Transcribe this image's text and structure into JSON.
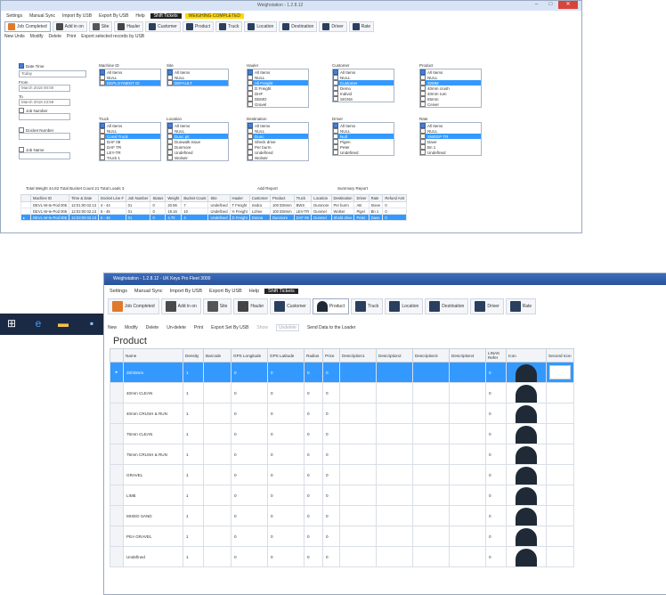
{
  "back_window": {
    "title": "Weighstation - 1.2.8.12",
    "menu": [
      "Settings",
      "Manual Sync",
      "Import By USB",
      "Export By USB",
      "Help"
    ],
    "menu_dark": "Shift Tickets",
    "menu_yellow": "WEIGHING COMPLETED",
    "tabs": [
      "Job Completed",
      "Add in on",
      "Site",
      "Hauler",
      "Customer",
      "Product",
      "Truck",
      "Location",
      "Destination",
      "Driver",
      "Rate"
    ],
    "toolbar": [
      "New Units",
      "Modify",
      "Delete",
      "Print",
      "Export selected records by USB"
    ],
    "filters": {
      "date_time": "Date Time",
      "today": "Today",
      "from": "From",
      "to": "To",
      "from_value": "March 2018 00:00",
      "to_value": "March 2018 23:59",
      "job_number": "Job Number",
      "docket_number": "Docket Number",
      "job_name": "Job Name",
      "groups": [
        {
          "label": "Machine ID",
          "items": [
            "All Items",
            "NULL",
            "DEPLOYMENT ID"
          ]
        },
        {
          "label": "Site",
          "items": [
            "All Items",
            "NULL",
            "DEFAULT"
          ]
        },
        {
          "label": "Hauler",
          "items": [
            "All Items",
            "NULL",
            "Ali Freight",
            "D Freight",
            "DHF",
            "DEMO",
            "Gravel"
          ]
        },
        {
          "label": "Customer",
          "items": [
            "All Items",
            "NULL",
            "Customer",
            "Demo",
            "Individ",
            "SIGNS"
          ]
        },
        {
          "label": "Product",
          "items": [
            "All Items",
            "NULL",
            "32MM",
            "40mm crush",
            "40mm rum",
            "65mm",
            "Ceiver"
          ]
        },
        {
          "label": "Truck",
          "items": [
            "All Items",
            "NULL",
            "Consl Truck",
            "DAF 08",
            "DAF TR",
            "LEY-TR",
            "Truck 1"
          ]
        },
        {
          "label": "Location",
          "items": [
            "All Items",
            "NULL",
            "Dunc pit",
            "Dunwalk issue",
            "Dunmore",
            "Undefined",
            "Wolseir"
          ]
        },
        {
          "label": "Destination",
          "items": [
            "All Items",
            "NULL",
            "Dunc",
            "Sheck drive",
            "Per burm",
            "Undefined",
            "Wolseir"
          ]
        },
        {
          "label": "Driver",
          "items": [
            "All Items",
            "NULL",
            "Null",
            "Pigen",
            "Peter",
            "Undefined"
          ]
        },
        {
          "label": "Rate",
          "items": [
            "All Items",
            "NULL",
            "SWEEP TR",
            "Dave",
            "Bn 1",
            "Undefined"
          ]
        }
      ]
    },
    "summary": "Total Weight 44.82  Total Bucket Count 21  Total Loads 3",
    "add_report": "Add Report",
    "summary_report": "Summary Report",
    "grid": {
      "columns": [
        "Machine ID",
        "Time & Date",
        "Docket Line #",
        "Job Number",
        "Status",
        "Weight",
        "Bucket Count",
        "Site",
        "Hauler",
        "Customer",
        "Product",
        "Truck",
        "Location",
        "Destination",
        "Driver",
        "Rate",
        "Refund Amt"
      ],
      "rows": [
        [
          "DEVL-W-te-Pod 005",
          "12:01:00 02.13",
          "4 - 44",
          "01",
          "0",
          "20.96",
          "7",
          "Undefined",
          "T Freight",
          "Sedra",
          "100 ID8mm",
          "BWS",
          "Dunmore",
          "Per burm",
          "AB",
          "Steve",
          "0"
        ],
        [
          "DEVL-W-te-Pod 005",
          "12:02:00 02.13",
          "5 - 45",
          "01",
          "0",
          "19.16",
          "10",
          "Undefined",
          "H Freight",
          "Lohne",
          "100 ID8mm",
          "LEV-TR",
          "Dunmel",
          "Wolser",
          "Pigel",
          "Bn 1",
          "0"
        ],
        [
          "DEVL-W-te-Pod 005",
          "12:03:00 02.13",
          "6 - 46",
          "01",
          "0",
          "4.70",
          "4",
          "Undefined",
          "D Freight",
          "Donna",
          "Dunmore",
          "DAF 08",
          "Dunmel",
          "Shold drive",
          "Peter",
          "Dave",
          "0"
        ]
      ]
    }
  },
  "front_window": {
    "title": "Weighstation - 1.2.8.12 - UK Keys Pro Fleet 3000",
    "menu": [
      "Settings",
      "Manual Sync",
      "Import By USB",
      "Export By USB",
      "Help"
    ],
    "menu_dark": "Shift Tickets",
    "tabs": [
      "Job Completed",
      "Add in on",
      "Site",
      "Hauler",
      "Customer",
      "Product",
      "Truck",
      "Location",
      "Destination",
      "Driver",
      "Rate"
    ],
    "active_tab": "Product",
    "toolbar": [
      "New",
      "Modify",
      "Delete",
      "Un-delete",
      "Print",
      "Export Set By USB",
      "Show",
      "Undelete",
      "Send Data to the Loader"
    ],
    "toolbar_dim": [
      "Show",
      "Undelete"
    ],
    "page_title": "Product",
    "grid": {
      "columns": [
        "Name",
        "Density",
        "Barcode",
        "GPS Longitude",
        "GPS Latitude",
        "Radius",
        "Price",
        "Description1",
        "Description2",
        "Description3",
        "Description4",
        "LINAK Refer",
        "Icon",
        "Second Icon"
      ],
      "rows": [
        [
          "20/40mm",
          "1",
          "",
          "0",
          "0",
          "0",
          "0",
          "",
          "",
          "",
          "",
          "0"
        ],
        [
          "40mm CLEAN",
          "1",
          "",
          "0",
          "0",
          "0",
          "0",
          "",
          "",
          "",
          "",
          "0"
        ],
        [
          "40mm CRUSH & RUN",
          "1",
          "",
          "0",
          "0",
          "0",
          "0",
          "",
          "",
          "",
          "",
          "0"
        ],
        [
          "75mm CLEAN",
          "1",
          "",
          "0",
          "0",
          "0",
          "0",
          "",
          "",
          "",
          "",
          "0"
        ],
        [
          "75mm CRUSH & RUN",
          "1",
          "",
          "0",
          "0",
          "0",
          "0",
          "",
          "",
          "",
          "",
          "0"
        ],
        [
          "GRAVEL",
          "1",
          "",
          "0",
          "0",
          "0",
          "0",
          "",
          "",
          "",
          "",
          "0"
        ],
        [
          "LIME",
          "1",
          "",
          "0",
          "0",
          "0",
          "0",
          "",
          "",
          "",
          "",
          "0"
        ],
        [
          "MIXED SAND",
          "1",
          "",
          "0",
          "0",
          "0",
          "0",
          "",
          "",
          "",
          "",
          "0"
        ],
        [
          "PEA GRAVEL",
          "1",
          "",
          "0",
          "0",
          "0",
          "0",
          "",
          "",
          "",
          "",
          "0"
        ],
        [
          "Undefined",
          "1",
          "",
          "0",
          "0",
          "0",
          "0",
          "",
          "",
          "",
          "",
          "0"
        ]
      ],
      "selected_row": 0
    }
  },
  "taskbar": {
    "icons": [
      "windows-icon",
      "ie-icon",
      "explorer-icon",
      "app-icon"
    ]
  },
  "colors": {
    "selection": "#3399ff",
    "titlebar_active": "#2a5299",
    "shift_tickets": "#222222",
    "weighing_completed": "#ffd800",
    "close_button": "#d9443a"
  }
}
